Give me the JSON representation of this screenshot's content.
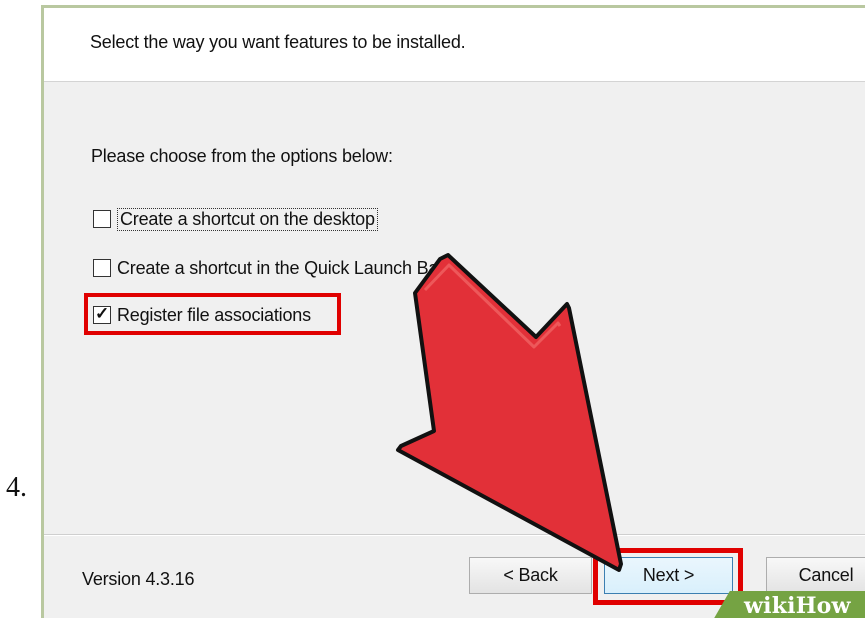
{
  "step": {
    "number": "4."
  },
  "dialog": {
    "header_text": "Select the way you want features to be installed.",
    "instruction": "Please choose from the options below:",
    "options": [
      {
        "label": "Create a shortcut on the desktop",
        "checked": false
      },
      {
        "label": "Create a shortcut in the Quick Launch Bar",
        "checked": false
      },
      {
        "label": "Register file associations",
        "checked": true
      }
    ],
    "version": "Version 4.3.16",
    "buttons": {
      "back": "< Back",
      "next": "Next >",
      "cancel": "Cancel"
    }
  },
  "annotations": {
    "highlight_color": "#e00000",
    "arrow_color": "#e23038",
    "arrow_icon": "large-pointing-arrow"
  },
  "watermark": {
    "text": "wikiHow",
    "color": "#75a343"
  }
}
